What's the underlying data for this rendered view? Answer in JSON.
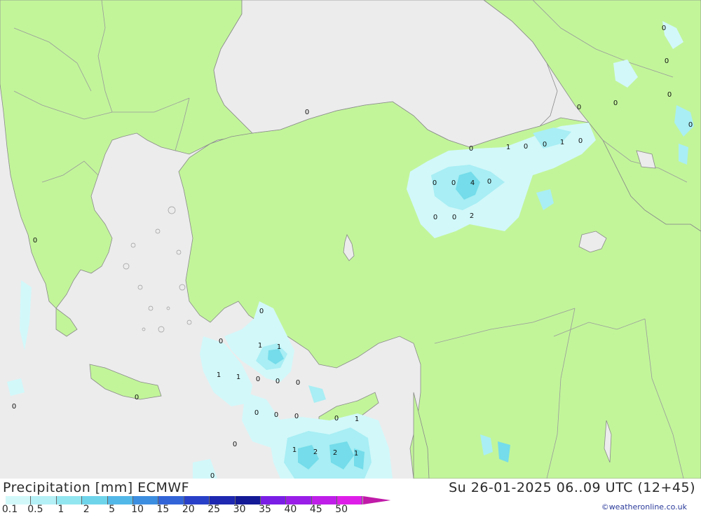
{
  "map": {
    "colors": {
      "sea": "#ececec",
      "land": "#c2f59a",
      "border": "#999999",
      "precip_light": "#d2f8fa",
      "precip_mid": "#a8eef4",
      "precip_strong": "#74dcea",
      "precip_max": "#52b8e8"
    },
    "labels": [
      "0",
      "0",
      "0",
      "0",
      "0",
      "0",
      "0",
      "1",
      "0",
      "0",
      "1",
      "0",
      "0",
      "0",
      "4",
      "0",
      "0",
      "0",
      "2",
      "0",
      "0",
      "0",
      "0",
      "1",
      "1",
      "1",
      "1",
      "0",
      "0",
      "0",
      "0",
      "0",
      "0",
      "0",
      "1",
      "0",
      "1",
      "2",
      "2",
      "1",
      "0",
      "0",
      "0"
    ]
  },
  "footer": {
    "title": "Precipitation [mm] ECMWF",
    "datetime": "Su 26-01-2025 06..09 UTC (12+45)",
    "credit": "©weatheronline.co.uk",
    "scale_colors": [
      "#d2f8fa",
      "#b4f0f6",
      "#92e6f0",
      "#6ed4ea",
      "#52b8e8",
      "#3c8ee0",
      "#3264d8",
      "#2840c8",
      "#1e28b0",
      "#141a96",
      "#7a1ee6",
      "#9a1ee8",
      "#be1ee8",
      "#de1ee8",
      "#c01aa8"
    ],
    "scale_labels": [
      "0.1",
      "0.5",
      "1",
      "2",
      "5",
      "10",
      "15",
      "20",
      "25",
      "30",
      "35",
      "40",
      "45",
      "50"
    ]
  }
}
